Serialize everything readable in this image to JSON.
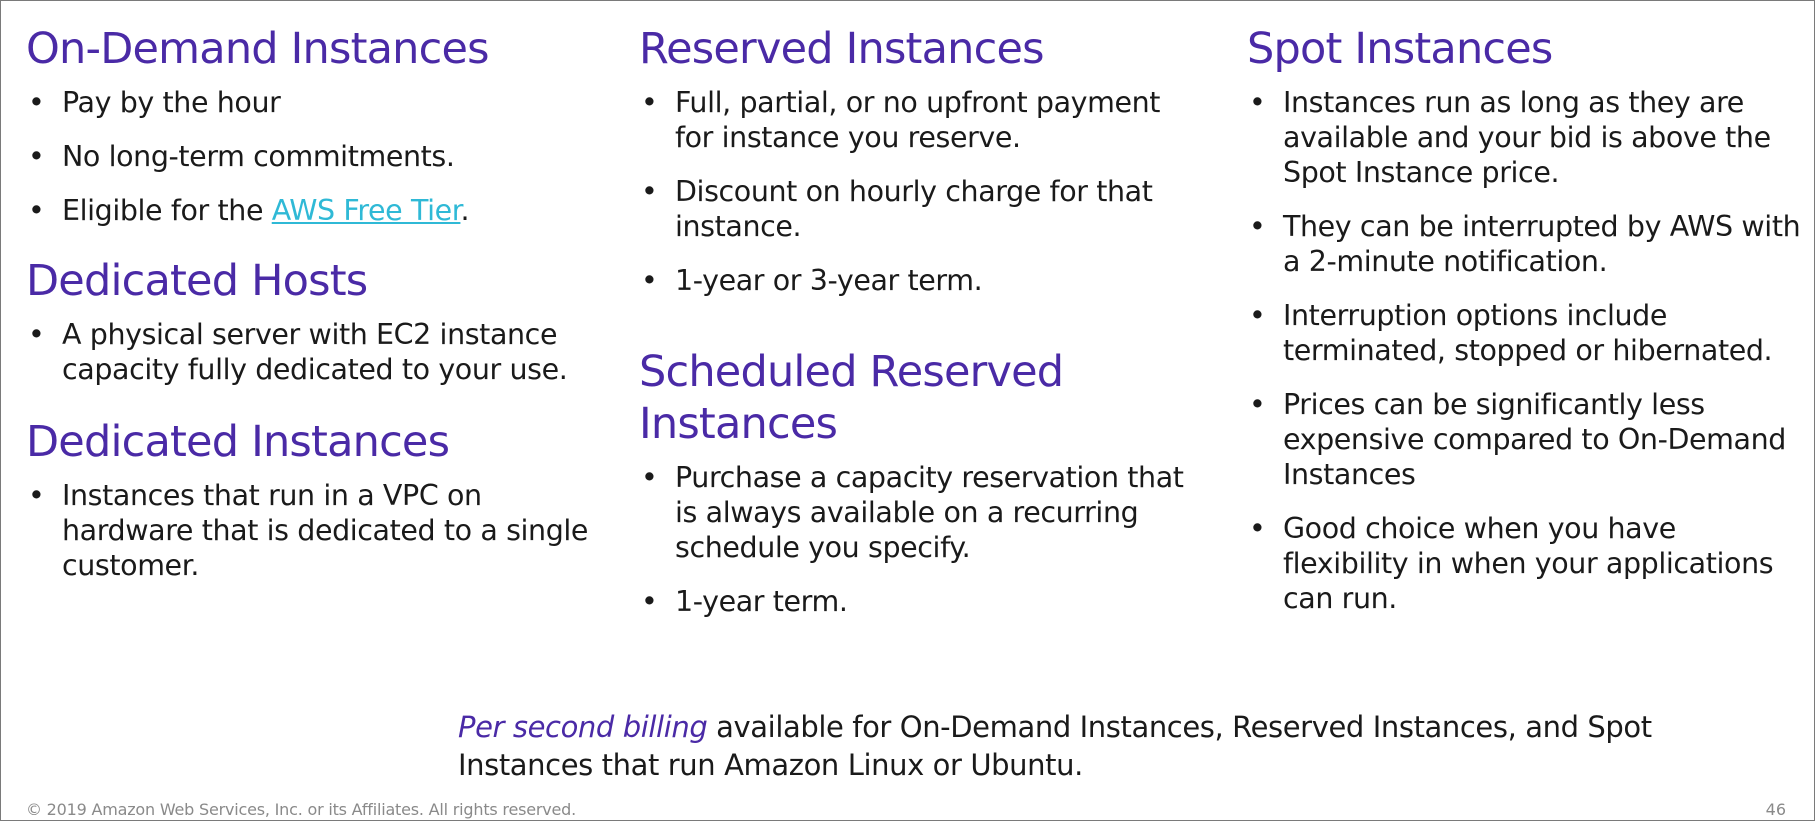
{
  "sections": {
    "on_demand": {
      "heading": "On-Demand Instances",
      "bullets": [
        "Pay by the hour",
        "No long-term commitments."
      ],
      "free_tier_prefix": "Eligible for the ",
      "free_tier_link": "AWS Free Tier",
      "free_tier_suffix": "."
    },
    "dedicated_hosts": {
      "heading": "Dedicated Hosts",
      "bullets": [
        "A physical server with EC2 instance capacity fully dedicated to your use."
      ]
    },
    "dedicated_instances": {
      "heading": "Dedicated Instances",
      "bullets": [
        "Instances that run in a VPC on hardware that is dedicated to a single customer."
      ]
    },
    "reserved": {
      "heading": "Reserved Instances",
      "bullets": [
        "Full, partial, or no upfront payment for instance you reserve.",
        "Discount on hourly charge for that instance.",
        "1-year or 3-year term."
      ]
    },
    "scheduled_reserved": {
      "heading": "Scheduled Reserved Instances",
      "bullets": [
        "Purchase a capacity reservation that is always available on a recurring schedule you specify.",
        "1-year term."
      ]
    },
    "spot": {
      "heading": "Spot Instances",
      "bullets": [
        "Instances run as long as they are available and your bid is above the Spot Instance price.",
        "They can be interrupted by AWS with a 2-minute notification.",
        "Interruption options include terminated, stopped or hibernated.",
        "Prices can be significantly less expensive compared to On-Demand Instances",
        "Good choice when you have flexibility in when your applications can run."
      ]
    }
  },
  "billing": {
    "emphasis": "Per second billing",
    "text": " available for On-Demand Instances, Reserved Instances, and Spot Instances that run Amazon Linux or Ubuntu."
  },
  "footer": {
    "copyright": "© 2019 Amazon Web Services, Inc. or its Affiliates. All rights reserved.",
    "page_number": "46"
  },
  "colors": {
    "heading": "#4a2aa6",
    "link": "#2fb9d6",
    "footer": "#8a8a8a"
  },
  "bullet_glyph": "•"
}
